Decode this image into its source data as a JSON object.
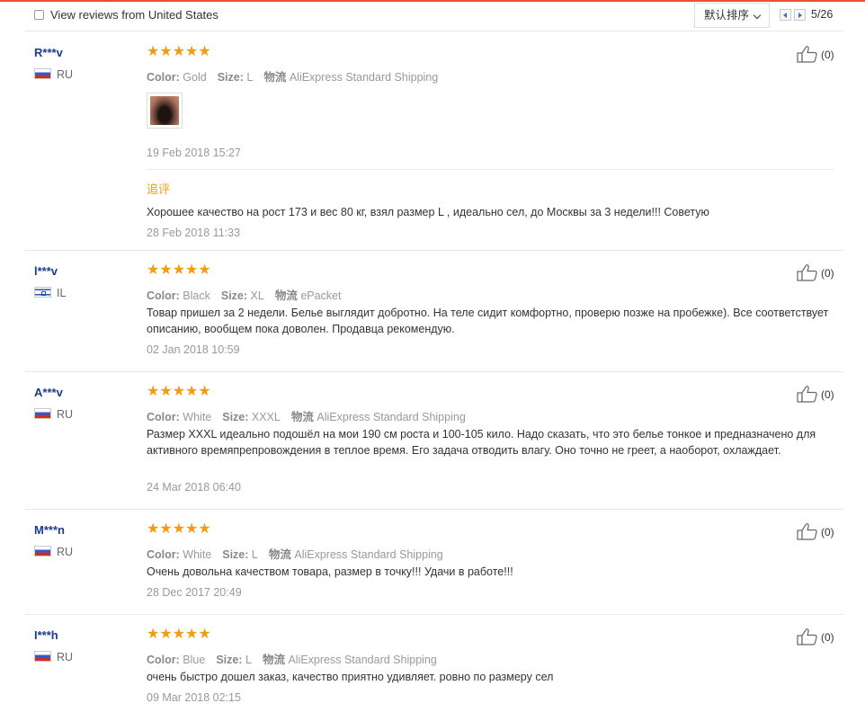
{
  "toolbar": {
    "filter_label": "View reviews from United States",
    "sort_label": "默认排序",
    "page_indicator": "5/26"
  },
  "colors": {
    "accent_line": "#e8522f",
    "star": "#f29c14",
    "user_name": "#1a3c8c",
    "muted_text": "#999999"
  },
  "icons": {
    "star": "star-icon",
    "helpful": "thumbs-up-icon",
    "prev": "arrow-left-icon",
    "next": "arrow-right-icon",
    "flag_ru": "flag-ru-icon",
    "flag_il": "flag-il-icon"
  },
  "reviews": [
    {
      "user": "R***v",
      "country": "RU",
      "rating": 5,
      "stars": "★★★★★",
      "color_label": "Color:",
      "color_value": "Gold",
      "size_label": "Size:",
      "size_value": "L",
      "shipping_label": "物流",
      "shipping_value": "AliExpress Standard Shipping",
      "date": "19 Feb 2018 15:27",
      "helpful": "(0)",
      "additional": {
        "label": "追评",
        "text": "Хорошее качество на рост 173 и вес 80 кг, взял размер L , идеально сел, до Москвы за 3 недели!!! Советую",
        "date": "28 Feb 2018 11:33"
      }
    },
    {
      "user": "l***v",
      "country": "IL",
      "rating": 5,
      "stars": "★★★★★",
      "color_label": "Color:",
      "color_value": "Black",
      "size_label": "Size:",
      "size_value": "XL",
      "shipping_label": "物流",
      "shipping_value": "ePacket",
      "text": "Товар пришел за 2 недели. Белье выглядит добротно. На теле сидит комфортно, проверю позже на пробежке). Все соответствует описанию, вообщем пока доволен. Продавца рекомендую.",
      "date": "02 Jan 2018 10:59",
      "helpful": "(0)"
    },
    {
      "user": "A***v",
      "country": "RU",
      "rating": 5,
      "stars": "★★★★★",
      "color_label": "Color:",
      "color_value": "White",
      "size_label": "Size:",
      "size_value": "XXXL",
      "shipping_label": "物流",
      "shipping_value": "AliExpress Standard Shipping",
      "text": "Размер XXXL идеально подошёл на мои 190 см роста и 100-105 кило. Надо сказать, что это белье тонкое и предназначено для активного времяпрепровождения в теплое время. Его задача отводить влагу. Оно точно не греет, а наоборот, охлаждает.",
      "date": "24 Mar 2018 06:40",
      "helpful": "(0)"
    },
    {
      "user": "M***n",
      "country": "RU",
      "rating": 5,
      "stars": "★★★★★",
      "color_label": "Color:",
      "color_value": "White",
      "size_label": "Size:",
      "size_value": "L",
      "shipping_label": "物流",
      "shipping_value": "AliExpress Standard Shipping",
      "text": "Очень довольна качеством товара, размер в точку!!! Удачи в работе!!!",
      "date": "28 Dec 2017 20:49",
      "helpful": "(0)"
    },
    {
      "user": "I***h",
      "country": "RU",
      "rating": 5,
      "stars": "★★★★★",
      "color_label": "Color:",
      "color_value": "Blue",
      "size_label": "Size:",
      "size_value": "L",
      "shipping_label": "物流",
      "shipping_value": "AliExpress Standard Shipping",
      "text": "очень быстро дошел заказ, качество приятно удивляет. ровно по размеру сел",
      "date": "09 Mar 2018 02:15",
      "helpful": "(0)"
    }
  ]
}
